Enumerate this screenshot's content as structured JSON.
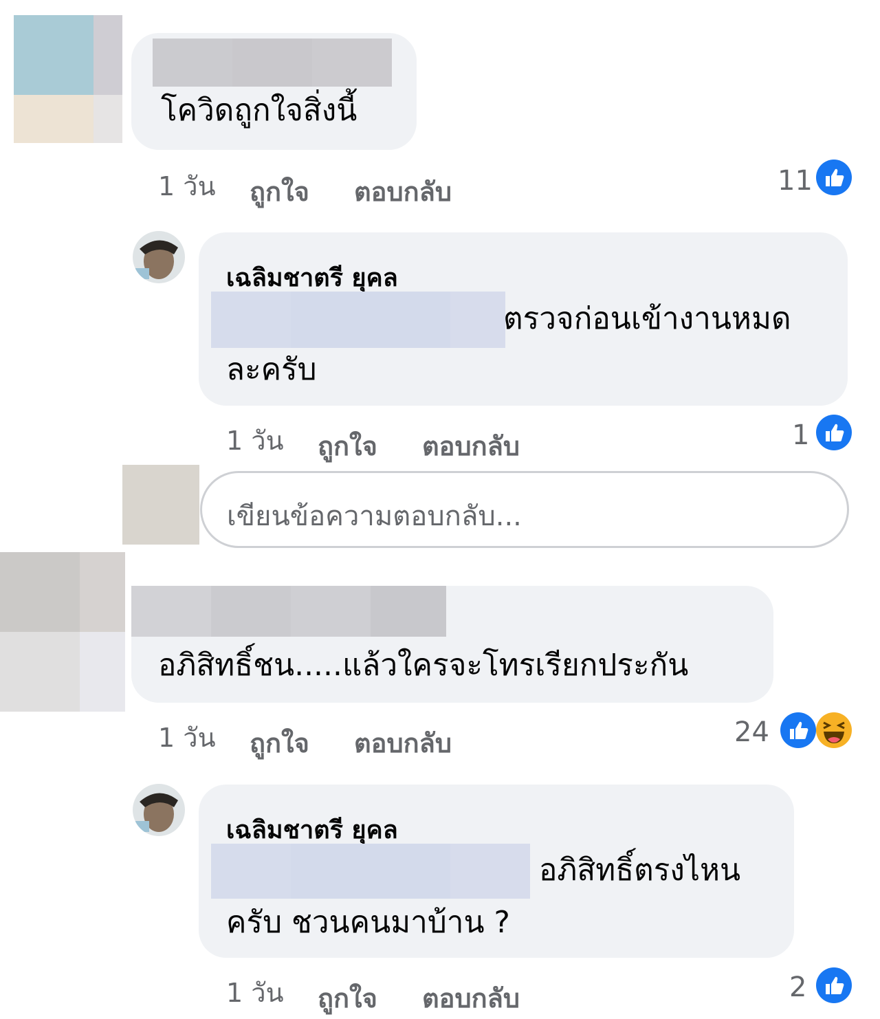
{
  "colors": {
    "like_blue": "#1877f2",
    "bubble_bg": "#f0f2f5",
    "meta_gray": "#65676b",
    "haha_yellow": "#f7b125"
  },
  "comments": [
    {
      "text": "โควิดถูกใจสิ่งนี้",
      "time": "1 วัน",
      "like_label": "ถูกใจ",
      "reply_label": "ตอบกลับ",
      "reaction_count": "11",
      "reactions": [
        "like-icon"
      ]
    },
    {
      "author": "เฉลิมชาตรี ยุคล",
      "text_line1": "ตรวจก่อนเข้างานหมด",
      "text_line2": "ละครับ",
      "time": "1 วัน",
      "like_label": "ถูกใจ",
      "reply_label": "ตอบกลับ",
      "reaction_count": "1",
      "reactions": [
        "like-icon"
      ]
    },
    {
      "reply_placeholder": "เขียนข้อความตอบกลับ..."
    },
    {
      "text": "อภิสิทธิ์ชน.....แล้วใครจะโทรเรียกประกัน",
      "time": "1 วัน",
      "like_label": "ถูกใจ",
      "reply_label": "ตอบกลับ",
      "reaction_count": "24",
      "reactions": [
        "like-icon",
        "haha-icon"
      ]
    },
    {
      "author": "เฉลิมชาตรี ยุคล",
      "text_line1": "อภิสิทธิ์ตรงไหน",
      "text_line2": "ครับ ชวนคนมาบ้าน ?",
      "time": "1 วัน",
      "like_label": "ถูกใจ",
      "reply_label": "ตอบกลับ",
      "reaction_count": "2",
      "reactions": [
        "like-icon"
      ]
    }
  ]
}
